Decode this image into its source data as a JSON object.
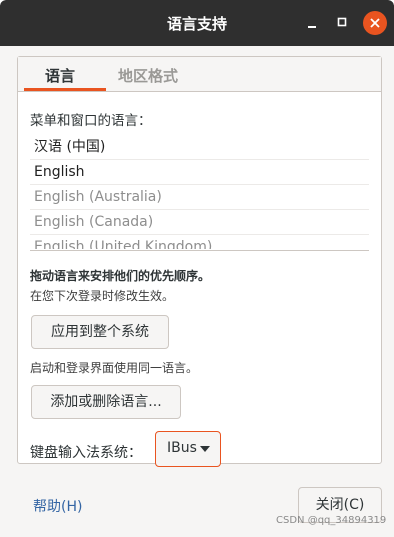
{
  "window": {
    "title": "语言支持"
  },
  "tabs": [
    {
      "label": "语言",
      "active": true
    },
    {
      "label": "地区格式",
      "active": false
    }
  ],
  "languages_section": {
    "label": "菜单和窗口的语言：",
    "items": [
      {
        "label": "汉语 (中国)",
        "active": true
      },
      {
        "label": "English",
        "active": true
      },
      {
        "label": "English (Australia)",
        "active": false
      },
      {
        "label": "English (Canada)",
        "active": false
      },
      {
        "label": "English (United Kingdom)",
        "active": false
      }
    ]
  },
  "hints": {
    "drag_order": "拖动语言来安排他们的优先顺序。",
    "next_login": "在您下次登录时修改生效。",
    "same_language": "启动和登录界面使用同一语言。"
  },
  "buttons": {
    "apply_system": "应用到整个系统",
    "add_remove": "添加或删除语言...",
    "close": "关闭(C)"
  },
  "keyboard": {
    "label": "键盘输入法系统：",
    "selected": "IBus"
  },
  "help": {
    "label": "帮助(H)"
  },
  "watermark": "CSDN @qq_34894319",
  "colors": {
    "accent": "#e95420",
    "titlebar": "#2f2f2f",
    "link": "#3465a4"
  }
}
